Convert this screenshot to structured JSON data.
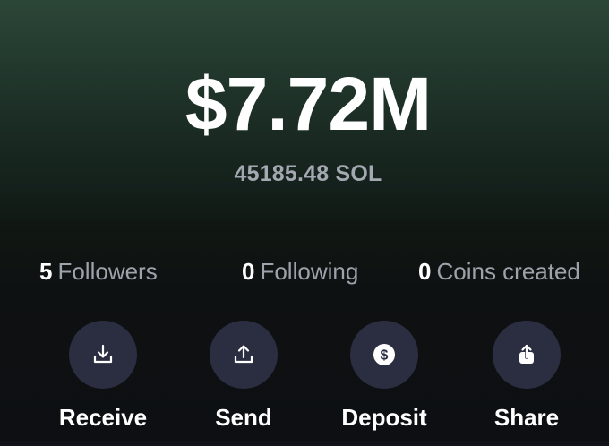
{
  "wallet": {
    "balance_usd": "$7.72M",
    "balance_sol": "45185.48 SOL"
  },
  "stats": {
    "followers": {
      "count": "5",
      "label": "Followers"
    },
    "following": {
      "count": "0",
      "label": "Following"
    },
    "coins_created": {
      "count": "0",
      "label": "Coins created"
    }
  },
  "actions": [
    {
      "label": "Receive",
      "icon": "download-tray-icon"
    },
    {
      "label": "Send",
      "icon": "upload-tray-icon"
    },
    {
      "label": "Deposit",
      "icon": "dollar-coin-icon"
    },
    {
      "label": "Share",
      "icon": "share-icon"
    }
  ],
  "colors": {
    "background_top": "#2c4638",
    "background_bottom": "#0d0f12",
    "button_circle": "#2a2e40",
    "primary_text": "#ffffff",
    "secondary_text": "#9da2ab"
  }
}
